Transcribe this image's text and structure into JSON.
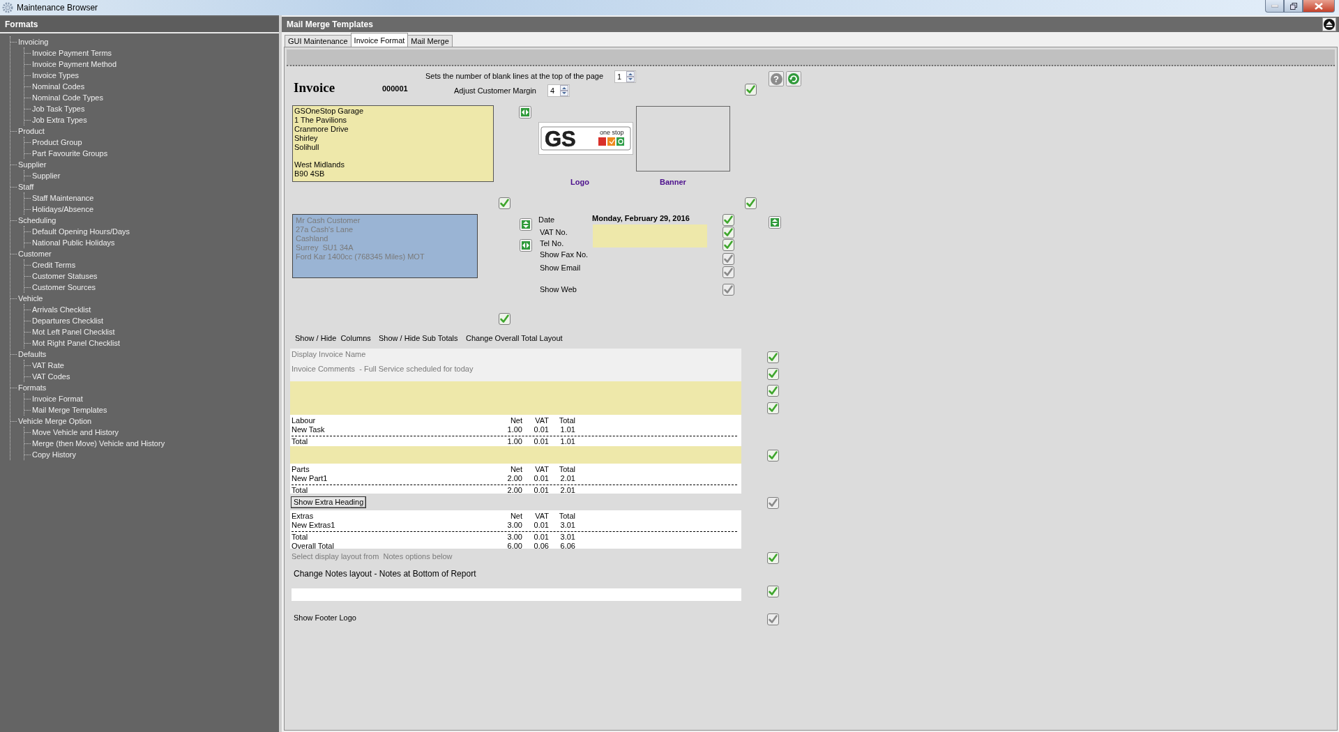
{
  "window": {
    "title": "Maintenance Browser"
  },
  "sidebar": {
    "title": "Formats",
    "tree": [
      {
        "label": "Invoicing",
        "children": [
          {
            "label": "Invoice Payment Terms"
          },
          {
            "label": "Invoice Payment Method"
          },
          {
            "label": "Invoice Types"
          },
          {
            "label": "Nominal Codes"
          },
          {
            "label": "Nominal Code Types"
          },
          {
            "label": "Job Task Types"
          },
          {
            "label": "Job Extra Types"
          }
        ]
      },
      {
        "label": "Product",
        "children": [
          {
            "label": "Product Group"
          },
          {
            "label": "Part Favourite Groups"
          }
        ]
      },
      {
        "label": "Supplier",
        "children": [
          {
            "label": "Supplier"
          }
        ]
      },
      {
        "label": "Staff",
        "children": [
          {
            "label": "Staff Maintenance"
          },
          {
            "label": "Holidays/Absence"
          }
        ]
      },
      {
        "label": "Scheduling",
        "children": [
          {
            "label": "Default Opening Hours/Days"
          },
          {
            "label": "National Public Holidays"
          }
        ]
      },
      {
        "label": "Customer",
        "children": [
          {
            "label": "Credit Terms"
          },
          {
            "label": "Customer Statuses"
          },
          {
            "label": "Customer Sources"
          }
        ]
      },
      {
        "label": "Vehicle",
        "children": [
          {
            "label": "Arrivals Checklist"
          },
          {
            "label": "Departures Checklist"
          },
          {
            "label": "Mot Left Panel Checklist"
          },
          {
            "label": "Mot Right Panel Checklist"
          }
        ]
      },
      {
        "label": "Defaults",
        "children": [
          {
            "label": "VAT Rate"
          },
          {
            "label": "VAT Codes"
          }
        ]
      },
      {
        "label": "Formats",
        "children": [
          {
            "label": "Invoice Format"
          },
          {
            "label": "Mail Merge Templates"
          }
        ]
      },
      {
        "label": "Vehicle Merge Option",
        "children": [
          {
            "label": "Move Vehicle and History"
          },
          {
            "label": "Merge (then Move) Vehicle and History"
          },
          {
            "label": "Copy History"
          }
        ]
      }
    ]
  },
  "panel": {
    "title": "Mail Merge Templates"
  },
  "tabs": [
    {
      "label": "GUI Maintenance",
      "selected": false
    },
    {
      "label": "Invoice Format",
      "selected": true
    },
    {
      "label": "Mail Merge",
      "selected": false
    }
  ],
  "designer": {
    "blank_lines": {
      "label": "Sets the number of blank lines at the top of the page",
      "value": "1"
    },
    "customer_margin": {
      "label": "Adjust Customer Margin",
      "value": "4"
    },
    "help_button": "?",
    "title": "Invoice",
    "number": "000001",
    "company_address": "GSOneStop Garage\n1 The Pavilions\nCranmore Drive\nShirley\nSolihull\n\nWest Midlands\nB90 4SB",
    "logo": {
      "mark": "GS",
      "tagline": "one stop"
    },
    "logo_label": "Logo",
    "banner_label": "Banner",
    "customer_address": "Mr Cash Customer\n27a Cash's Lane\nCashland\nSurrey  SU1 34A\nFord Kar 1400cc (768345 Miles) MOT",
    "date_value": "Monday, February 29, 2016",
    "detail_rows": [
      {
        "label": "Date",
        "checked": true
      },
      {
        "label": "VAT No.",
        "checked": true
      },
      {
        "label": "Tel No.",
        "checked": true
      },
      {
        "label": "Show Fax No.",
        "checked": false
      },
      {
        "label": "Show Email",
        "checked": false
      },
      {
        "label": "Show Web",
        "checked": false
      }
    ],
    "layout_links": [
      "Show / Hide  Columns",
      "Show / Hide Sub Totals",
      "Change Overall Total Layout"
    ],
    "invoice_name_label": "Display Invoice Name",
    "comments": "Invoice Comments  - Full Service scheduled for today",
    "sections": [
      {
        "heading": "Labour",
        "columns": [
          "Net",
          "VAT",
          "Total"
        ],
        "items": [
          {
            "label": "New Task",
            "values": [
              "1.00",
              "0.01",
              "1.01"
            ]
          }
        ],
        "totals": [
          {
            "label": "Total",
            "values": [
              "1.00",
              "0.01",
              "1.01"
            ]
          }
        ]
      },
      {
        "heading": "Parts",
        "columns": [
          "Net",
          "VAT",
          "Total"
        ],
        "items": [
          {
            "label": "New Part1",
            "values": [
              "2.00",
              "0.01",
              "2.01"
            ]
          }
        ],
        "totals": [
          {
            "label": "Total",
            "values": [
              "2.00",
              "0.01",
              "2.01"
            ]
          }
        ]
      },
      {
        "heading": "Extras",
        "columns": [
          "Net",
          "VAT",
          "Total"
        ],
        "items": [
          {
            "label": "New Extras1",
            "values": [
              "3.00",
              "0.01",
              "3.01"
            ]
          }
        ],
        "totals": [
          {
            "label": "Total",
            "values": [
              "3.00",
              "0.01",
              "3.01"
            ]
          },
          {
            "label": "Overall Total",
            "values": [
              "6.00",
              "0.06",
              "6.06"
            ]
          }
        ]
      }
    ],
    "extra_heading_button": "Show Extra Heading",
    "notes_hint": "Select display layout from  Notes options below",
    "notes_layout": "Change Notes layout - Notes at Bottom of Report",
    "footer_logo_label": "Show Footer Logo",
    "option_checks": [
      {
        "checked": true
      },
      {
        "checked": true
      },
      {
        "checked": true
      },
      {
        "checked": true
      },
      {
        "checked": true
      },
      {
        "checked": true
      },
      {
        "checked": true
      },
      {
        "checked": true
      },
      {
        "checked": true
      },
      {
        "checked": false
      },
      {
        "checked": true
      },
      {
        "checked": true
      },
      {
        "checked": false
      }
    ]
  }
}
